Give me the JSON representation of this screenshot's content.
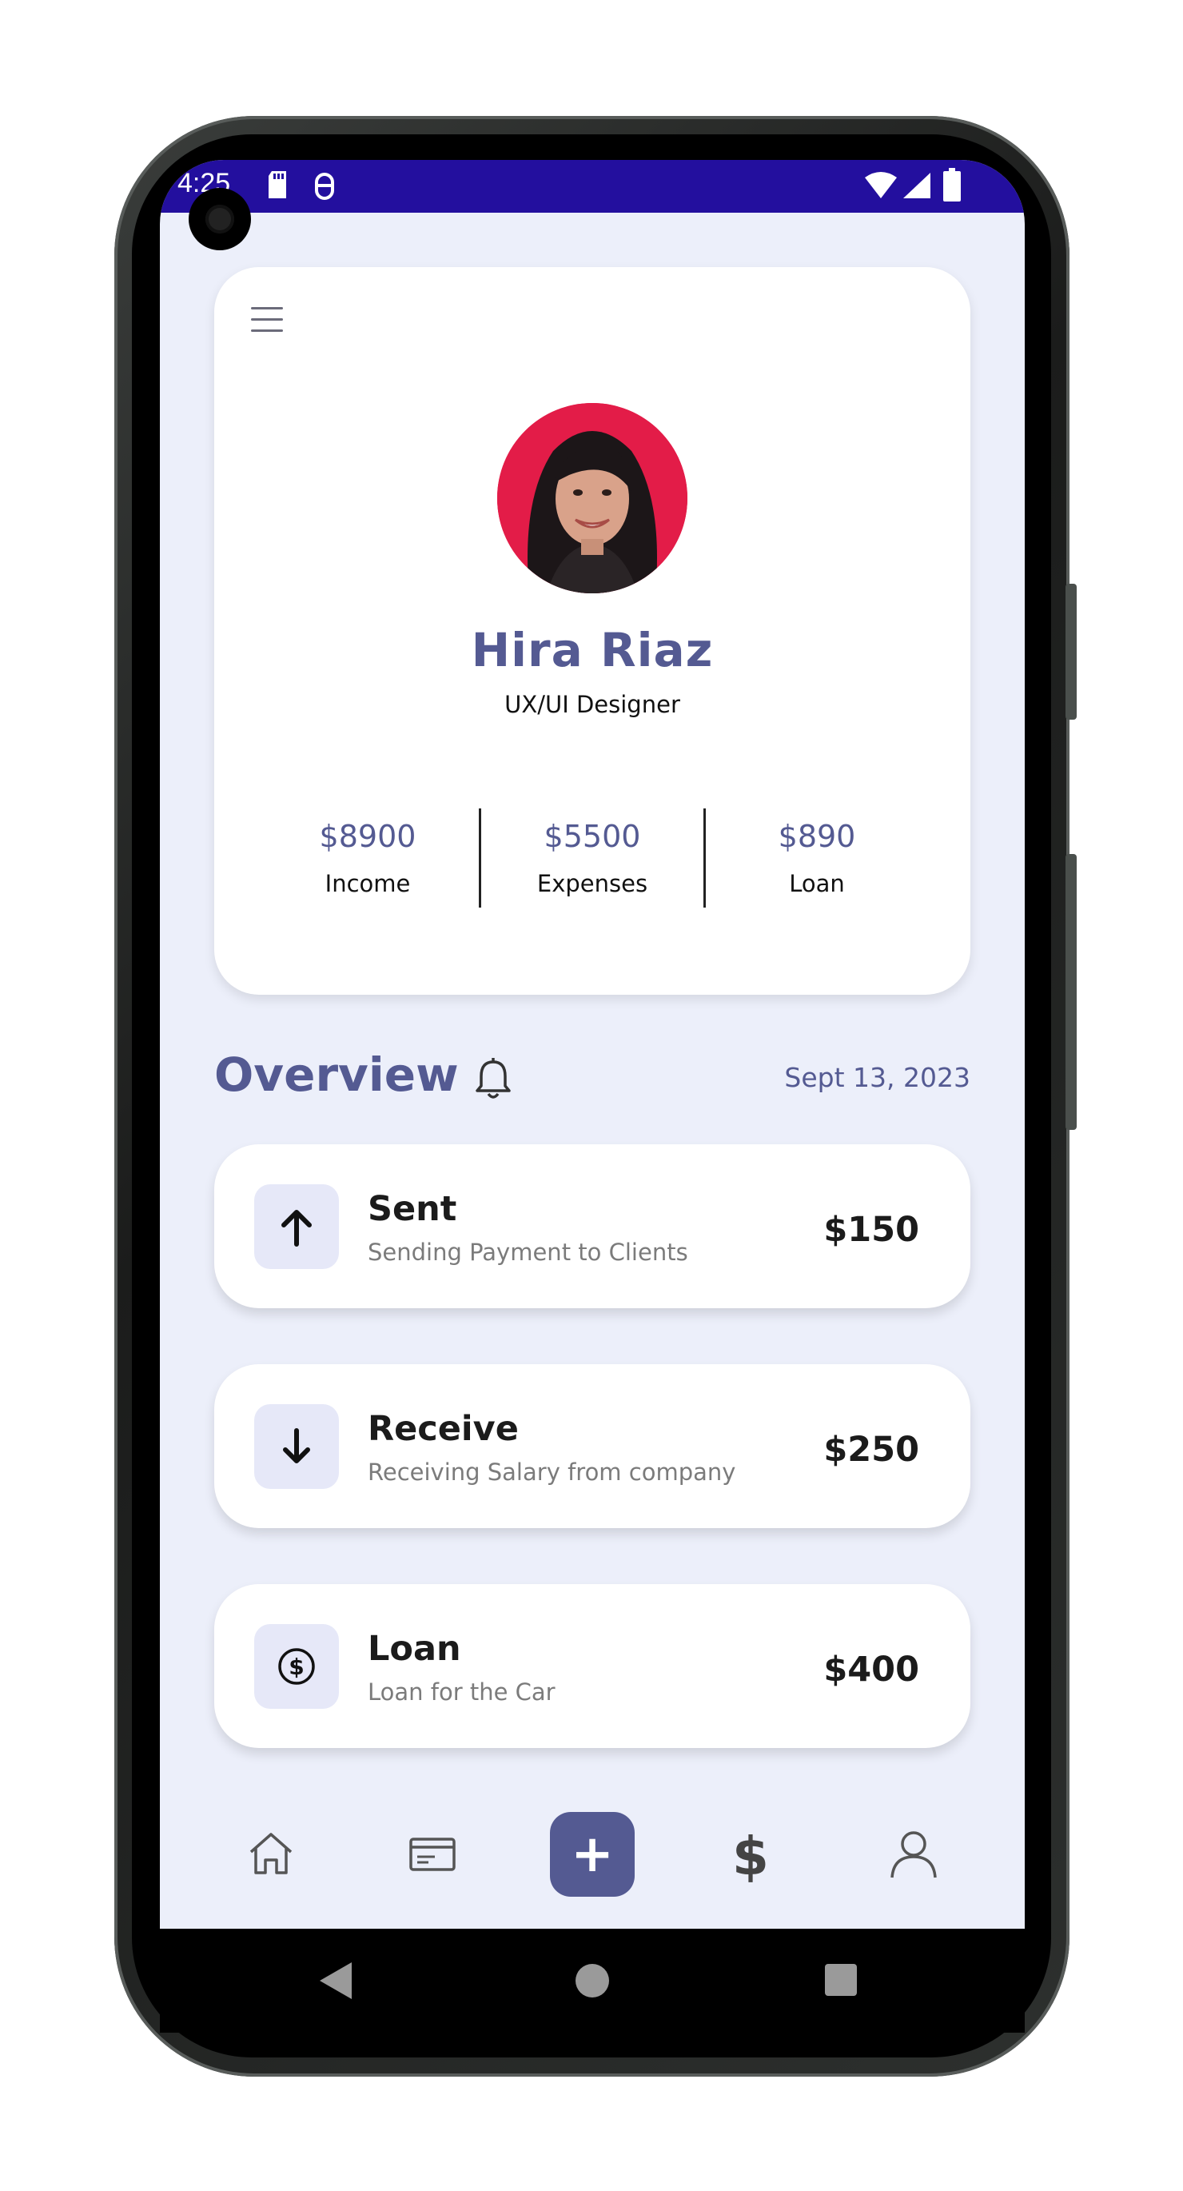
{
  "status_bar": {
    "time": "4:25"
  },
  "profile": {
    "name": "Hira Riaz",
    "role": "UX/UI Designer",
    "stats": [
      {
        "value": "$8900",
        "label": "Income"
      },
      {
        "value": "$5500",
        "label": "Expenses"
      },
      {
        "value": "$890",
        "label": "Loan"
      }
    ]
  },
  "overview": {
    "title": "Overview",
    "date": "Sept 13, 2023"
  },
  "transactions": [
    {
      "icon": "arrow-up-icon",
      "title": "Sent",
      "subtitle": "Sending Payment to Clients",
      "amount": "$150"
    },
    {
      "icon": "arrow-down-icon",
      "title": "Receive",
      "subtitle": "Receiving Salary from company",
      "amount": "$250"
    },
    {
      "icon": "dollar-circle-icon",
      "title": "Loan",
      "subtitle": "Loan for the Car",
      "amount": "$400"
    }
  ],
  "bottom_nav": {
    "items": [
      "home-icon",
      "card-icon",
      "add-icon",
      "dollar-icon",
      "profile-icon"
    ],
    "fab_symbol": "+",
    "dollar_symbol": "$"
  },
  "colors": {
    "accent": "#545a92",
    "status_bar": "#230f9e",
    "background": "#eceffa",
    "avatar_bg": "#e31c48"
  }
}
